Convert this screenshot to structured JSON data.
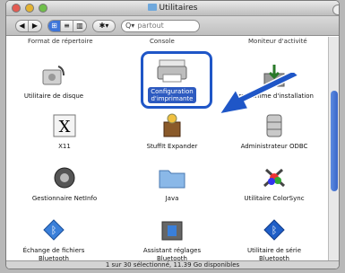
{
  "window": {
    "title": "Utilitaires"
  },
  "toolbar": {
    "back": "◀",
    "forward": "▶",
    "search_placeholder": "partout",
    "view_icon": "⊞",
    "view_list": "≡",
    "view_column": "▥",
    "action": "✱▾"
  },
  "cut_row": [
    "Format de répertoire",
    "Console",
    "Moniteur d'activité"
  ],
  "items": [
    {
      "label": "Utilitaire de disque",
      "line2": ""
    },
    {
      "label": "Configuration",
      "line2": "d'imprimante"
    },
    {
      "label": "Programme d'installation",
      "line2": ""
    },
    {
      "label": "X11",
      "line2": ""
    },
    {
      "label": "StuffIt Expander",
      "line2": ""
    },
    {
      "label": "Administrateur ODBC",
      "line2": ""
    },
    {
      "label": "Gestionnaire NetInfo",
      "line2": ""
    },
    {
      "label": "Java",
      "line2": ""
    },
    {
      "label": "Utilitaire ColorSync",
      "line2": ""
    },
    {
      "label": "Échange de fichiers",
      "line2": "Bluetooth"
    },
    {
      "label": "Assistant réglages",
      "line2": "Bluetooth"
    },
    {
      "label": "Utilitaire de série",
      "line2": "Bluetooth"
    }
  ],
  "status": "1 sur 30 sélectionné, 11.39 Go disponibles",
  "colors": {
    "selection": "#2d5ac0",
    "highlight": "#1f56c7"
  }
}
